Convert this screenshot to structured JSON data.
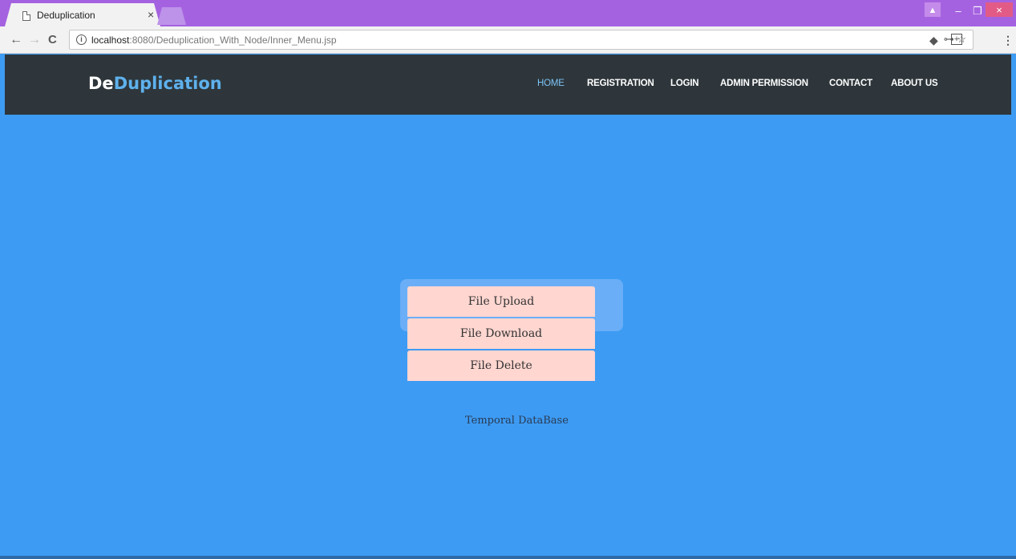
{
  "browser": {
    "tab_title": "Deduplication",
    "tab_close": "×",
    "url_host": "localhost",
    "url_rest": ":8080/Deduplication_With_Node/Inner_Menu.jsp",
    "info_glyph": "i",
    "back_glyph": "←",
    "forward_glyph": "→",
    "reload_glyph": "C",
    "key_glyph": "⊶",
    "star_glyph": "☆",
    "eraser_glyph": "◆",
    "plus_glyph": "+",
    "menu_glyph": "⋮",
    "user_glyph": "▲",
    "min_glyph": "–",
    "max_glyph": "❐",
    "close_glyph": "×"
  },
  "site": {
    "brand_part1": "De",
    "brand_part2": "Duplication",
    "brand_colors": {
      "part1": "#ffffff",
      "part2": "#5eb1ec"
    },
    "nav": [
      {
        "label": "HOME",
        "active": true
      },
      {
        "label": "REGISTRATION",
        "active": false
      },
      {
        "label": "LOGIN",
        "active": false
      },
      {
        "label": "ADMIN PERMISSION",
        "active": false
      },
      {
        "label": "CONTACT",
        "active": false
      },
      {
        "label": "ABOUT US",
        "active": false
      }
    ]
  },
  "main": {
    "buttons": [
      {
        "label": "File Upload"
      },
      {
        "label": "File Download"
      },
      {
        "label": "File Delete"
      }
    ],
    "db_link": "Temporal DataBase"
  },
  "colors": {
    "background": "#3d9bf3",
    "navbar": "#2e363b",
    "button": "#ffd6d0",
    "active_nav": "#7cc3f6"
  }
}
